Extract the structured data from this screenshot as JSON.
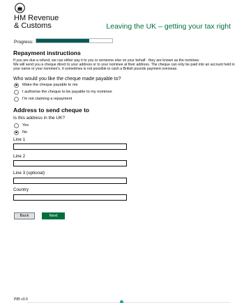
{
  "header": {
    "logo_line1": "HM Revenue",
    "logo_line2": "& Customs",
    "service_title": "Leaving the UK – getting your tax right",
    "crest_icon": "royal-crest-icon"
  },
  "progress": {
    "label": "Progress:",
    "fraction": 0.7,
    "fill_color": "#005a5a"
  },
  "repayment": {
    "heading": "Repayment instructions",
    "paragraph_lines": [
      "If you are due a refund, we can either pay it to you or someone else on your behalf - they are known as the nominee.",
      "We will send you a cheque direct to your address or to your nominee at their address. The cheque can only be paid into an account held in",
      "your name or your nominee's. It sometimes is not possible to cash a British pounds payment overseas."
    ],
    "question": "Who would you like the cheque made payable to?",
    "options": [
      {
        "label": "Make the cheque payable to me",
        "selected": true
      },
      {
        "label": "I authorise the cheque to be payable to my nominee",
        "selected": false
      },
      {
        "label": "I'm not claiming a repayment",
        "selected": false
      }
    ]
  },
  "address": {
    "heading": "Address to send cheque to",
    "question": "Is this address in the UK?",
    "options": [
      {
        "label": "Yes",
        "selected": false
      },
      {
        "label": "No",
        "selected": true
      }
    ],
    "fields": [
      {
        "label": "Line 1",
        "value": ""
      },
      {
        "label": "Line 2",
        "value": ""
      },
      {
        "label": "Line 3 (optional)",
        "value": ""
      },
      {
        "label": "Country",
        "value": ""
      }
    ]
  },
  "buttons": {
    "back": "Back",
    "next": "Next"
  },
  "footer": {
    "version": "P85 v3.0"
  },
  "colors": {
    "brand_green": "#00703c",
    "progress_teal": "#005a5a"
  }
}
